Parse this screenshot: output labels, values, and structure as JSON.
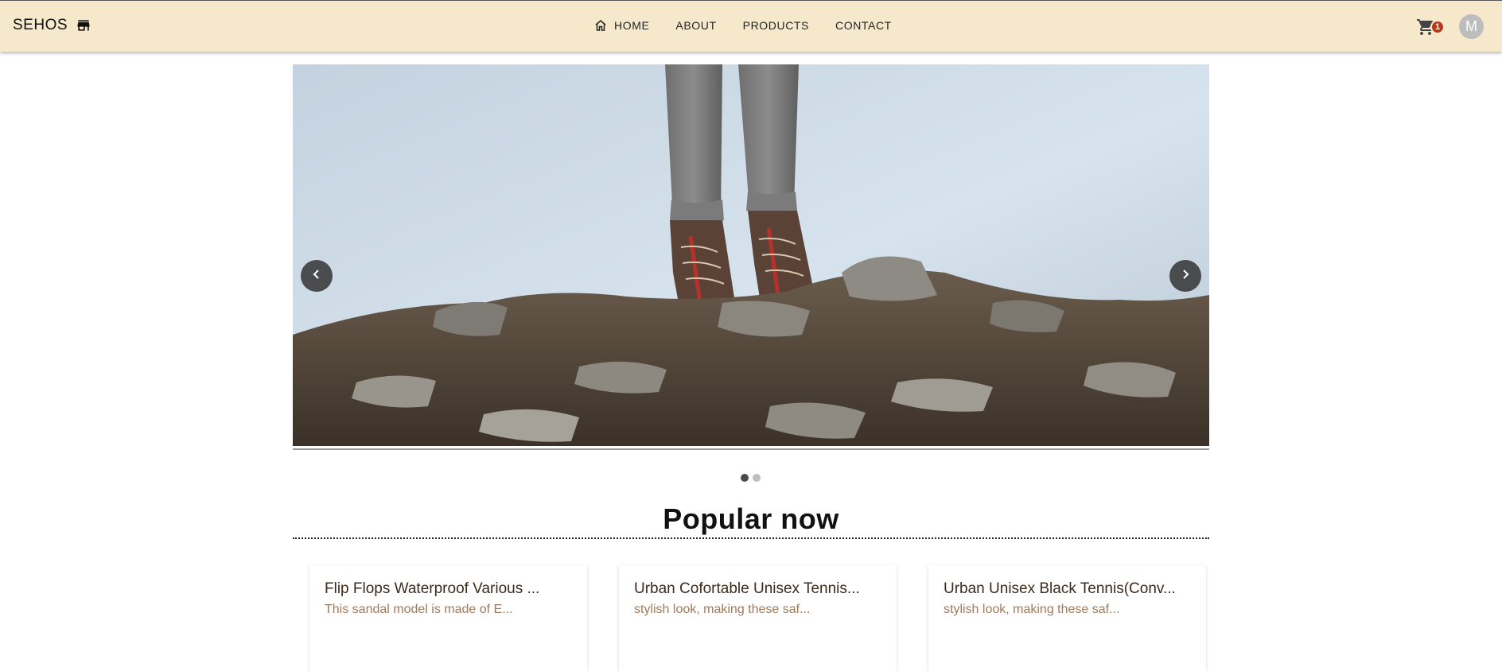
{
  "header": {
    "brand": "SEHOS",
    "brand_icon": "store-icon",
    "nav": [
      {
        "label": "HOME",
        "icon": "home-icon"
      },
      {
        "label": "ABOUT"
      },
      {
        "label": "PRODUCTS"
      },
      {
        "label": "CONTACT"
      }
    ],
    "cart_icon": "cart-icon",
    "cart_count": "1",
    "avatar_initial": "M"
  },
  "carousel": {
    "slide_description": "hiking-boots-on-rocky-hill",
    "prev_icon": "chevron-left-icon",
    "next_icon": "chevron-right-icon",
    "slide_count": 2,
    "active_index": 0
  },
  "section": {
    "title": "Popular now"
  },
  "products": [
    {
      "title": "Flip Flops Waterproof Various ...",
      "description": "This sandal model is made of E..."
    },
    {
      "title": "Urban Cofortable Unisex Tennis...",
      "description": "stylish look, making these saf..."
    },
    {
      "title": "Urban Unisex Black Tennis(Conv...",
      "description": "stylish look, making these saf..."
    }
  ],
  "colors": {
    "header_bg": "#f6e8cb",
    "badge": "#b8381a",
    "product_title": "#3d2a1c",
    "product_desc": "#a07a5a"
  }
}
